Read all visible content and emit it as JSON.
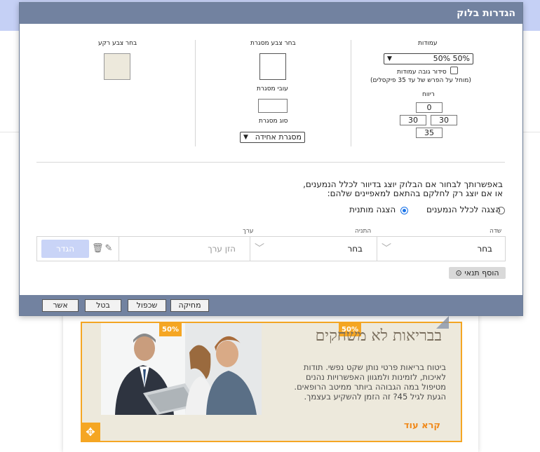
{
  "dialog": {
    "title": "הגדרות בלוק",
    "columns": {
      "label": "עמודות",
      "selected": "50% 50%",
      "uniform_height_label": "סידור גובה עמודות",
      "uniform_height_hint": "(מוחל על הפרש של עד 35 פיקסלים)",
      "spacing_label": "ריווח",
      "spacing_top": "0",
      "spacing_right": "30",
      "spacing_left": "30",
      "spacing_bottom": "35"
    },
    "border": {
      "color_label": "בחר צבע מסגרת",
      "width_label": "עובי מסגרת",
      "width_value": "",
      "type_label": "סוג מסגרת",
      "type_selected": "מסגרת אחידה"
    },
    "background": {
      "color_label": "בחר צבע רקע",
      "color_value": "#ede9dc"
    },
    "visibility": {
      "description_line1": "באפשרותך לבחור אם הבלוק יוצג בדיוור לכלל הנמענים,",
      "description_line2": "או אם יוצג רק לחלקם בהתאם למאפיינים שלהם:",
      "option_all": "הצגה לכלל הנמענים",
      "option_conditional": "הצגה מותנית",
      "selected": "conditional"
    },
    "condition": {
      "field_header": "שדה",
      "operator_header": "התניה",
      "value_header": "ערך",
      "field_value": "בחר",
      "operator_value": "בחר",
      "value_placeholder": "הזן ערך",
      "define_button": "הגדר",
      "add_condition_button": "הוסף תנאי",
      "add_icon": "⊙",
      "trash_icon": "🗑",
      "pencil_icon": "✎"
    },
    "footer": {
      "confirm": "אשר",
      "cancel": "בטל",
      "duplicate": "שכפול",
      "delete": "מחיקה"
    }
  },
  "background_block": {
    "left_badge": "50%",
    "right_badge": "50%",
    "title": "בבריאות לא משחקים",
    "body": "ביטוח בריאות פרטי נותן שקט נפשי. תודות לאיכות, לזמינות ולמגוון האפשרויות נהנים מטיפול במה הגבוהה ביותר ממיטב הרופאים. הגעת לגיל 45? זה הזמן להשקיע בעצמך.",
    "read_more": "קרא עוד",
    "move_icon": "✥",
    "accent": "#f5a623",
    "block_bg": "#ede9dc"
  },
  "colors": {
    "header": "#7282a0",
    "topbar": "#c5d0f5",
    "define_button": "#c9d4f7",
    "radio_selected": "#1a73e8"
  }
}
